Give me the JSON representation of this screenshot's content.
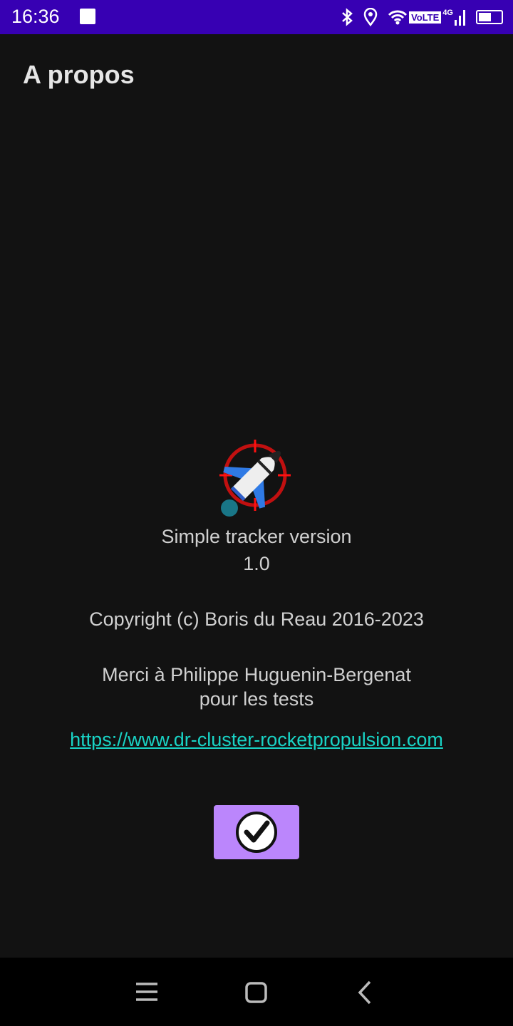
{
  "status_bar": {
    "time": "16:36",
    "network": "4G",
    "volte": "VoLTE",
    "battery_percent": 50,
    "icons": [
      "gallery-icon",
      "bluetooth-icon",
      "location-icon",
      "wifi-icon",
      "volte-icon",
      "signal-icon",
      "battery-icon"
    ]
  },
  "header": {
    "title": "A propos"
  },
  "about": {
    "app_line": "Simple tracker version",
    "version": "1.0",
    "copyright": "Copyright (c) Boris du Reau 2016-2023",
    "thanks_line1": "Merci à Philippe Huguenin-Bergenat",
    "thanks_line2": "pour les tests",
    "link": "https://www.dr-cluster-rocketpropulsion.com"
  },
  "ok_button": {
    "icon": "check-circle-icon",
    "color": "#bb86fc"
  },
  "nav_bar": {
    "icons": [
      "menu-icon",
      "home-icon",
      "back-icon"
    ]
  },
  "colors": {
    "status_bar": "#3700b3",
    "background": "#121212",
    "link": "#19d3c5"
  }
}
